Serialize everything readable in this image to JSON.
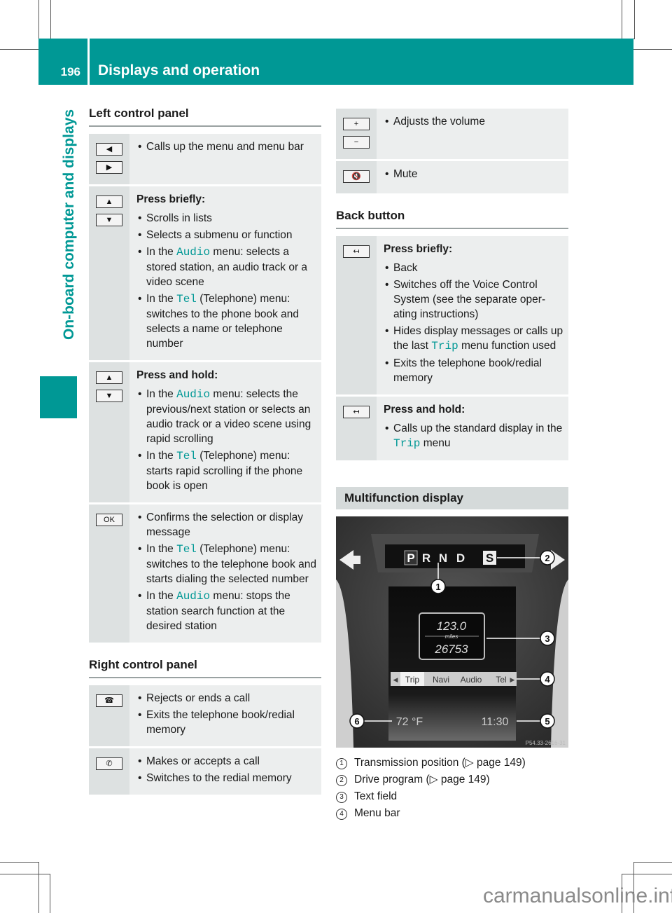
{
  "header": {
    "page_number": "196",
    "title": "Displays and operation"
  },
  "side_tab": "On-board computer and displays",
  "left_control_panel": {
    "title": "Left control panel",
    "rows": [
      {
        "keys": [
          "◀",
          "▶"
        ],
        "key_icons": [
          "left-arrow-key-icon",
          "right-arrow-key-icon"
        ],
        "heading": "",
        "bullets": [
          {
            "pre": "Calls up the menu and menu bar",
            "mono": "",
            "post": ""
          }
        ]
      },
      {
        "keys": [
          "▲",
          "▼"
        ],
        "key_icons": [
          "up-arrow-key-icon",
          "down-arrow-key-icon"
        ],
        "heading": "Press briefly:",
        "bullets": [
          {
            "pre": "Scrolls in lists",
            "mono": "",
            "post": ""
          },
          {
            "pre": "Selects a submenu or function",
            "mono": "",
            "post": ""
          },
          {
            "pre": "In the ",
            "mono": "Audio",
            "post": " menu: selects a stored station, an audio track or a video scene"
          },
          {
            "pre": "In the ",
            "mono": "Tel",
            "post": " (Telephone) menu: switches to the phone book and selects a name or telephone number"
          }
        ]
      },
      {
        "keys": [
          "▲",
          "▼"
        ],
        "key_icons": [
          "up-arrow-key-icon",
          "down-arrow-key-icon"
        ],
        "heading": "Press and hold:",
        "bullets": [
          {
            "pre": "In the ",
            "mono": "Audio",
            "post": " menu: selects the previous/next station or selects an audio track or a video scene using rapid scrolling"
          },
          {
            "pre": "In the ",
            "mono": "Tel",
            "post": " (Telephone) menu: starts rapid scrolling if the phone book is open"
          }
        ]
      },
      {
        "keys": [
          "OK"
        ],
        "key_icons": [
          "ok-key-icon"
        ],
        "heading": "",
        "bullets": [
          {
            "pre": "Confirms the selection or display message",
            "mono": "",
            "post": ""
          },
          {
            "pre": "In the ",
            "mono": "Tel",
            "post": " (Telephone) menu: switches to the telephone book and starts dialing the selected number"
          },
          {
            "pre": "In the ",
            "mono": "Audio",
            "post": " menu: stops the station search function at the desired station"
          }
        ]
      }
    ]
  },
  "right_control_panel": {
    "title": "Right control panel",
    "rows": [
      {
        "keys": [
          "☎"
        ],
        "key_icons": [
          "end-call-key-icon"
        ],
        "heading": "",
        "bullets": [
          {
            "pre": "Rejects or ends a call",
            "mono": "",
            "post": ""
          },
          {
            "pre": "Exits the telephone book/redial memory",
            "mono": "",
            "post": ""
          }
        ]
      },
      {
        "keys": [
          "✆"
        ],
        "key_icons": [
          "accept-call-key-icon"
        ],
        "heading": "",
        "bullets": [
          {
            "pre": "Makes or accepts a call",
            "mono": "",
            "post": ""
          },
          {
            "pre": "Switches to the redial memory",
            "mono": "",
            "post": ""
          }
        ]
      },
      {
        "keys": [
          "+",
          "−"
        ],
        "key_icons": [
          "volume-up-key-icon",
          "volume-down-key-icon"
        ],
        "heading": "",
        "bullets": [
          {
            "pre": "Adjusts the volume",
            "mono": "",
            "post": ""
          }
        ]
      },
      {
        "keys": [
          "🔇"
        ],
        "key_icons": [
          "mute-key-icon"
        ],
        "heading": "",
        "bullets": [
          {
            "pre": "Mute",
            "mono": "",
            "post": ""
          }
        ]
      }
    ]
  },
  "back_button": {
    "title": "Back button",
    "rows": [
      {
        "keys": [
          "↤"
        ],
        "key_icons": [
          "back-key-icon"
        ],
        "heading": "Press briefly:",
        "bullets": [
          {
            "pre": "Back",
            "mono": "",
            "post": ""
          },
          {
            "pre": "Switches off the Voice Control System (see the separate oper-ating instructions)",
            "mono": "",
            "post": ""
          },
          {
            "pre": "Hides display messages or calls up the last ",
            "mono": "Trip",
            "post": " menu function used"
          },
          {
            "pre": "Exits the telephone book/redial memory",
            "mono": "",
            "post": ""
          }
        ]
      },
      {
        "keys": [
          "↤"
        ],
        "key_icons": [
          "back-key-icon"
        ],
        "heading": "Press and hold:",
        "bullets": [
          {
            "pre": "Calls up the standard display in the ",
            "mono": "Trip",
            "post": " menu"
          }
        ]
      }
    ]
  },
  "multifunction_display": {
    "title": "Multifunction display",
    "gear_positions": [
      "P",
      "R",
      "N",
      "D"
    ],
    "drive_program": "S",
    "text_field": {
      "top": "123.0",
      "unit": "miles",
      "bottom": "26753"
    },
    "menu_bar": [
      "Trip",
      "Navi",
      "Audio",
      "Tel"
    ],
    "temperature": "72 °F",
    "time": "11:30",
    "image_code": "P54.33-2616-31",
    "callouts": [
      "1",
      "2",
      "3",
      "4",
      "5",
      "6"
    ],
    "legend": [
      {
        "num": "1",
        "text": "Transmission position (▷ page 149)"
      },
      {
        "num": "2",
        "text": "Drive program (▷ page 149)"
      },
      {
        "num": "3",
        "text": "Text field"
      },
      {
        "num": "4",
        "text": "Menu bar"
      }
    ]
  },
  "watermark": "carmanualsonline.info",
  "colors": {
    "accent": "#009895",
    "key_cell": "#dde1e1",
    "text_cell": "#eceeee"
  }
}
